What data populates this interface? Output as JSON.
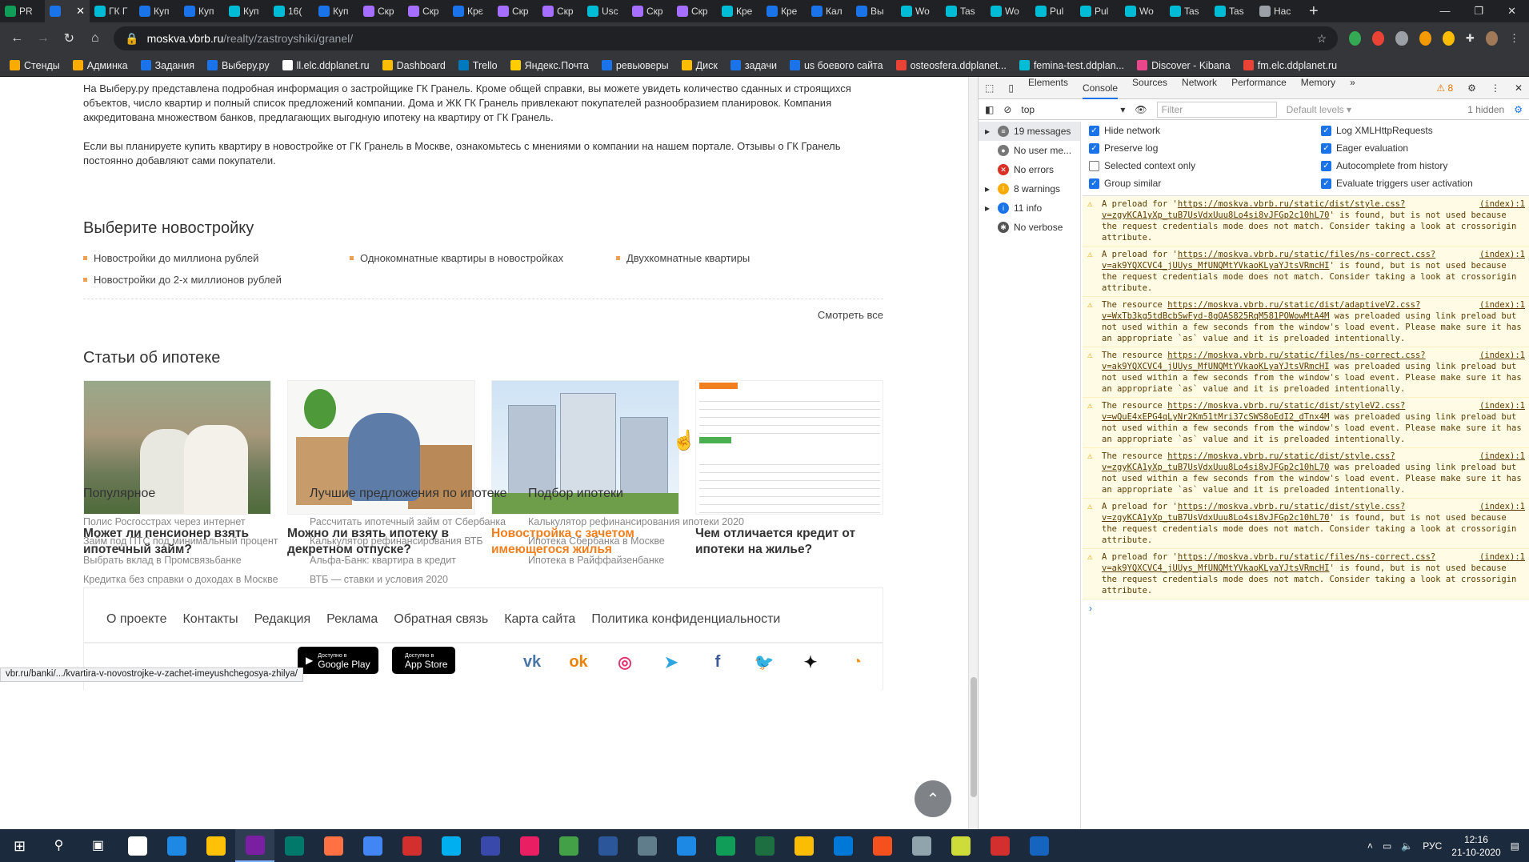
{
  "browser": {
    "tabs": [
      {
        "label": "PR",
        "color": "#0f9d58"
      },
      {
        "label": "",
        "color": "#1a73e8",
        "active": true
      },
      {
        "label": "ГК Г",
        "color": "#00bcd4"
      },
      {
        "label": "Куп",
        "color": "#1a73e8"
      },
      {
        "label": "Куп",
        "color": "#1a73e8"
      },
      {
        "label": "Куп",
        "color": "#00bcd4"
      },
      {
        "label": "16(",
        "color": "#00bcd4"
      },
      {
        "label": "Куп",
        "color": "#1a73e8"
      },
      {
        "label": "Скр",
        "color": "#a56eff"
      },
      {
        "label": "Скр",
        "color": "#a56eff"
      },
      {
        "label": "Крє",
        "color": "#1a73e8"
      },
      {
        "label": "Скр",
        "color": "#a56eff"
      },
      {
        "label": "Скр",
        "color": "#a56eff"
      },
      {
        "label": "Usc",
        "color": "#00bcd4"
      },
      {
        "label": "Скр",
        "color": "#a56eff"
      },
      {
        "label": "Скр",
        "color": "#a56eff"
      },
      {
        "label": "Кре",
        "color": "#00bcd4"
      },
      {
        "label": "Кре",
        "color": "#1a73e8"
      },
      {
        "label": "Кал",
        "color": "#1a73e8"
      },
      {
        "label": "Вы",
        "color": "#1a73e8"
      },
      {
        "label": "Wo",
        "color": "#00bcd4"
      },
      {
        "label": "Tas",
        "color": "#00bcd4"
      },
      {
        "label": "Wo",
        "color": "#00bcd4"
      },
      {
        "label": "Pul",
        "color": "#00bcd4"
      },
      {
        "label": "Pul",
        "color": "#00bcd4"
      },
      {
        "label": "Wo",
        "color": "#00bcd4"
      },
      {
        "label": "Tas",
        "color": "#00bcd4"
      },
      {
        "label": "Tas",
        "color": "#00bcd4"
      },
      {
        "label": "Нас",
        "color": "#9aa0a6"
      }
    ],
    "new_tab": "+",
    "win_controls": [
      "—",
      "❐",
      "✕"
    ],
    "url_host": "moskva.vbrb.ru",
    "url_path": "/realty/zastroyshiki/granel/",
    "bookmarks": [
      {
        "label": "Стенды",
        "color": "#f9ab00"
      },
      {
        "label": "Админка",
        "color": "#f9ab00"
      },
      {
        "label": "Задания",
        "color": "#1a73e8"
      },
      {
        "label": "Выберу.ру",
        "color": "#1a73e8"
      },
      {
        "label": "ll.elc.ddplanet.ru",
        "color": "#fff"
      },
      {
        "label": "Dashboard",
        "color": "#fbbc04"
      },
      {
        "label": "Trello",
        "color": "#0079bf"
      },
      {
        "label": "Яндекс.Почта",
        "color": "#ffcc00"
      },
      {
        "label": "ревьюверы",
        "color": "#1a73e8"
      },
      {
        "label": "Диск",
        "color": "#fbbc04"
      },
      {
        "label": "задачи",
        "color": "#1a73e8"
      },
      {
        "label": "us боевого сайта",
        "color": "#1a73e8"
      },
      {
        "label": "osteosfera.ddplanet...",
        "color": "#ea4335"
      },
      {
        "label": "femina-test.ddplan...",
        "color": "#00bcd4"
      },
      {
        "label": "Discover - Kibana",
        "color": "#e8488b"
      },
      {
        "label": "fm.elc.ddplanet.ru",
        "color": "#ea4335"
      }
    ],
    "status_url": "vbr.ru/banki/.../kvartira-v-novostrojke-v-zachet-imeyushchegosya-zhilya/"
  },
  "page": {
    "intro_p1": "На Выберу.ру представлена подробная информация о застройщике ГК Гранель. Кроме общей справки, вы можете увидеть количество сданных и строящихся объектов, число квартир и полный список предложений компании. Дома и ЖК ГК Гранель привлекают покупателей разнообразием планировок. Компания аккредитована множеством банков, предлагающих выгодную ипотеку на квартиру от ГК Гранель.",
    "intro_p2": "Если вы планируете купить квартиру в новостройке от ГК Гранель в Москве, ознакомьтесь с мнениями о компании на нашем портале. Отзывы о ГК Гранель постоянно добавляют сами покупатели.",
    "choose_title": "Выберите новостройку",
    "choose_links": [
      "Новостройки до миллиона рублей",
      "Однокомнатные квартиры в новостройках",
      "Двухкомнатные квартиры",
      "Новостройки до 2-х миллионов рублей"
    ],
    "see_all": "Смотреть все",
    "articles_title": "Статьи об ипотеке",
    "articles": [
      {
        "title": "Может ли пенсионер взять ипотечный займ?"
      },
      {
        "title": "Можно ли взять ипотеку в декретном отпуске?"
      },
      {
        "title": "Новостройка с зачетом имеющегося жилья"
      },
      {
        "title": "Чем отличается кредит от ипотеки на жилье?"
      }
    ],
    "cols": [
      {
        "title": "Популярное",
        "links": [
          "Полис Росгосстрах через интернет",
          "Займ под ПТС под минимальный процент",
          "Выбрать вклад в Промсвязьбанке",
          "Кредитка без справки о доходах в Москве"
        ]
      },
      {
        "title": "Лучшие предложения по ипотеке",
        "links": [
          "Рассчитать ипотечный займ от Сбербанка",
          "Калькулятор рефинансирования ВТБ",
          "Альфа-Банк: квартира в кредит",
          "ВТБ — ставки и условия 2020"
        ]
      },
      {
        "title": "Подбор ипотеки",
        "links": [
          "Калькулятор рефинансирования ипотеки 2020",
          "Ипотека Сбербанка в Москве",
          "Ипотека в Райффайзенбанке"
        ]
      }
    ],
    "footer_nav": [
      "О проекте",
      "Контакты",
      "Редакция",
      "Реклама",
      "Обратная связь",
      "Карта сайта",
      "Политика конфиденциальности"
    ],
    "store_google_small": "Доступно в",
    "store_google": "Google Play",
    "store_apple_small": "Доступно в",
    "store_apple": "App Store",
    "social": [
      {
        "name": "vk-icon",
        "glyph": "vk",
        "color": "#4a76a8"
      },
      {
        "name": "odnoklassniki-icon",
        "glyph": "ok",
        "color": "#ee8208"
      },
      {
        "name": "instagram-icon",
        "glyph": "◎",
        "color": "#e1306c"
      },
      {
        "name": "telegram-icon",
        "glyph": "➤",
        "color": "#2ca5e0"
      },
      {
        "name": "facebook-icon",
        "glyph": "f",
        "color": "#3b5998"
      },
      {
        "name": "twitter-icon",
        "glyph": "🐦",
        "color": "#1da1f2"
      },
      {
        "name": "zen-icon",
        "glyph": "✦",
        "color": "#111"
      },
      {
        "name": "rss-icon",
        "glyph": "◔",
        "color": "#f7931e"
      }
    ],
    "highlight_color": "#f07f1e"
  },
  "devtools": {
    "tabs": [
      "Elements",
      "Console",
      "Sources",
      "Network",
      "Performance",
      "Memory",
      "»"
    ],
    "warn_count": "⚠ 8",
    "context": "top",
    "filter_placeholder": "Filter",
    "levels": "Default levels ▾",
    "hidden": "1 hidden",
    "sidebar": [
      {
        "label": "19 messages",
        "icon_color": "#777",
        "glyph": "≡"
      },
      {
        "label": "No user me...",
        "icon_color": "#777",
        "glyph": "●"
      },
      {
        "label": "No errors",
        "icon_color": "#d93025",
        "glyph": "✕"
      },
      {
        "label": "8 warnings",
        "icon_color": "#f9ab00",
        "glyph": "!"
      },
      {
        "label": "11 info",
        "icon_color": "#1a73e8",
        "glyph": "i"
      },
      {
        "label": "No verbose",
        "icon_color": "#555",
        "glyph": "✱"
      }
    ],
    "settings": [
      {
        "label": "Hide network",
        "on": true
      },
      {
        "label": "Log XMLHttpRequests",
        "on": true
      },
      {
        "label": "Preserve log",
        "on": true
      },
      {
        "label": "Eager evaluation",
        "on": true
      },
      {
        "label": "Selected context only",
        "on": false
      },
      {
        "label": "Autocomplete from history",
        "on": true
      },
      {
        "label": "Group similar",
        "on": true
      },
      {
        "label": "Evaluate triggers user activation",
        "on": true
      }
    ],
    "messages": [
      {
        "pre": "A preload for '",
        "link": "https://moskva.vbrb.ru/static/dist/style.css?v=zgyKCA1yXp_tuB7UsVdxUuu8Lo4si8vJFGp2c10hL70",
        "post": "' is found, but is not used because the request credentials mode does not match. Consider taking a look at crossorigin attribute.",
        "src": "(index):1"
      },
      {
        "pre": "A preload for '",
        "link": "https://moskva.vbrb.ru/static/files/ns-correct.css?v=ak9YQXCVC4_jUUys_MfUNQMtYVkaoKLyaYJtsVRmcHI",
        "post": "' is found, but is not used because the request credentials mode does not match. Consider taking a look at crossorigin attribute.",
        "src": "(index):1"
      },
      {
        "pre": "The resource ",
        "link": "https://moskva.vbrb.ru/static/dist/adaptiveV2.css?v=WxTb3kg5tdBcbSwFyd-8gOAS825RqM581POWowMtA4M",
        "post": " was preloaded using link preload but not used within a few seconds from the window's load event. Please make sure it has an appropriate `as` value and it is preloaded intentionally.",
        "src": "(index):1"
      },
      {
        "pre": "The resource ",
        "link": "https://moskva.vbrb.ru/static/files/ns-correct.css?v=ak9YQXCVC4_jUUys_MfUNQMtYVkaoKLyaYJtsVRmcHI",
        "post": " was preloaded using link preload but not used within a few seconds from the window's load event. Please make sure it has an appropriate `as` value and it is preloaded intentionally.",
        "src": "(index):1"
      },
      {
        "pre": "The resource ",
        "link": "https://moskva.vbrb.ru/static/dist/styleV2.css?v=wQuE4xEPG4qLyNr2Km51tMri37cSWS8oEdI2_dTnx4M",
        "post": " was preloaded using link preload but not used within a few seconds from the window's load event. Please make sure it has an appropriate `as` value and it is preloaded intentionally.",
        "src": "(index):1"
      },
      {
        "pre": "The resource ",
        "link": "https://moskva.vbrb.ru/static/dist/style.css?v=zgyKCA1yXp_tuB7UsVdxUuu8Lo4si8vJFGp2c10hL70",
        "post": " was preloaded using link preload but not used within a few seconds from the window's load event. Please make sure it has an appropriate `as` value and it is preloaded intentionally.",
        "src": "(index):1"
      },
      {
        "pre": "A preload for '",
        "link": "https://moskva.vbrb.ru/static/dist/style.css?v=zgyKCA1yXp_tuB7UsVdxUuu8Lo4si8vJFGp2c10hL70",
        "post": "' is found, but is not used because the request credentials mode does not match. Consider taking a look at crossorigin attribute.",
        "src": "(index):1"
      },
      {
        "pre": "A preload for '",
        "link": "https://moskva.vbrb.ru/static/files/ns-correct.css?v=ak9YQXCVC4_jUUys_MfUNQMtYVkaoKLyaYJtsVRmcHI",
        "post": "' is found, but is not used because the request credentials mode does not match. Consider taking a look at crossorigin attribute.",
        "src": "(index):1"
      }
    ],
    "prompt": "›"
  },
  "taskbar": {
    "apps": [
      "#ffffff",
      "#1e88e5",
      "#ffc107",
      "#7b1fa2",
      "#00796b",
      "#ff7043",
      "#4285f4",
      "#d32f2f",
      "#00aff0",
      "#3949ab",
      "#e91e63",
      "#43a047",
      "#2b579a",
      "#607d8b",
      "#1e88e5",
      "#0f9d58",
      "#1d6f42",
      "#fbbc04",
      "#0078d7",
      "#f4511e",
      "#90a4ae",
      "#cddc39",
      "#d32f2f",
      "#1565c0"
    ],
    "lang": "РУС",
    "time": "12:16",
    "date": "21-10-2020"
  }
}
